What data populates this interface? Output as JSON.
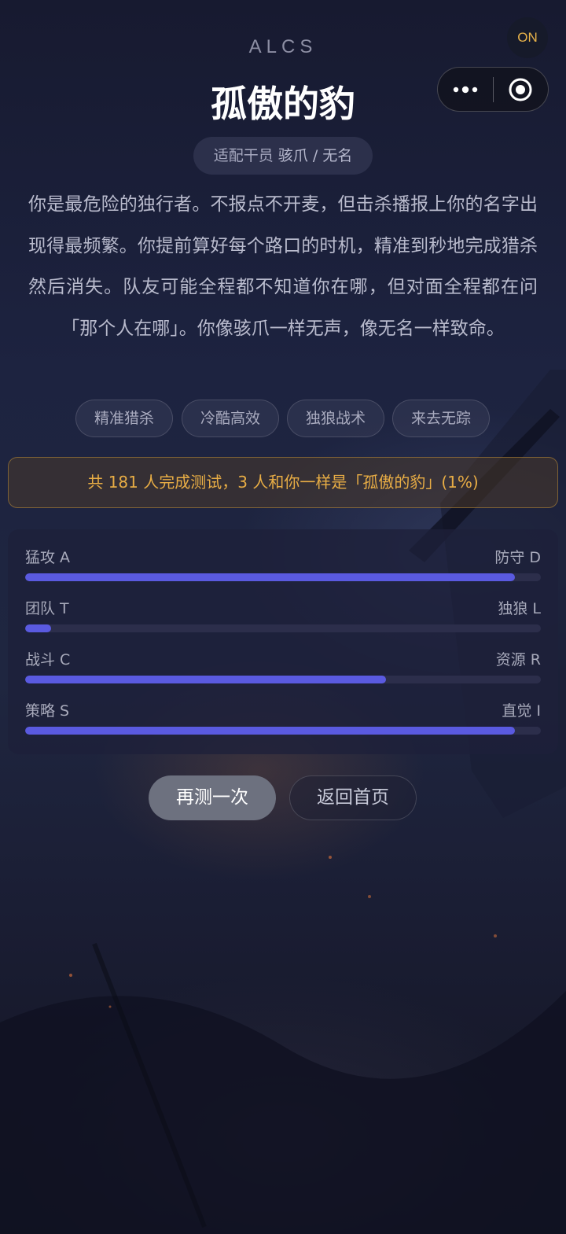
{
  "status_badge": "ON",
  "brand": "ALCS",
  "result": {
    "title": "孤傲的豹",
    "operator_label": "适配干员",
    "operators": "骇爪 / 无名",
    "description": "你是最危险的独行者。不报点不开麦，但击杀播报上你的名字出现得最频繁。你提前算好每个路口的时机，精准到秒地完成猎杀然后消失。队友可能全程都不知道你在哪，但对面全程都在问「那个人在哪」。你像骇爪一样无声，像无名一样致命。",
    "tags": [
      "精准猎杀",
      "冷酷高效",
      "独狼战术",
      "来去无踪"
    ]
  },
  "stats_banner": "共 181 人完成测试，3 人和你一样是「孤傲的豹」(1%)",
  "dimensions": [
    {
      "left": "猛攻 A",
      "right": "防守 D",
      "value_pct": 95
    },
    {
      "left": "团队 T",
      "right": "独狼 L",
      "value_pct": 5
    },
    {
      "left": "战斗 C",
      "right": "资源 R",
      "value_pct": 70
    },
    {
      "left": "策略 S",
      "right": "直觉 I",
      "value_pct": 95
    }
  ],
  "buttons": {
    "retry": "再测一次",
    "home": "返回首页"
  },
  "colors": {
    "accent_gold": "#e8ad45",
    "bar_fill": "#5a5ae0",
    "bar_track": "#2c2e4b"
  },
  "icons": {
    "more": "more-dots-icon",
    "close": "target-circle-icon"
  }
}
